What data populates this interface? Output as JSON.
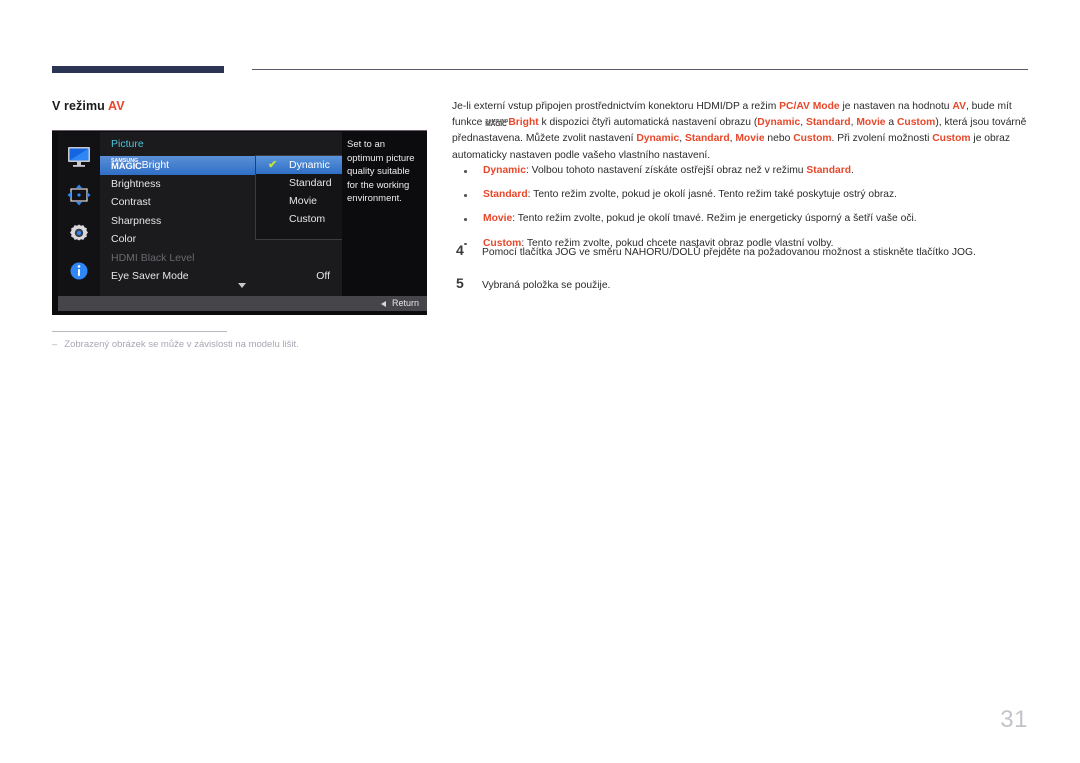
{
  "header": {
    "bar_accent_color": "#2b3553",
    "rule_color": "#5a5a6e"
  },
  "section": {
    "heading_prefix": "V režimu ",
    "heading_accent": "AV"
  },
  "osd": {
    "title": "Picture",
    "sidebar_icons": [
      "monitor-icon",
      "move-arrows-icon",
      "gear-icon",
      "info-icon"
    ],
    "menu_items": [
      {
        "label_prefix": "",
        "logo": "SAMSUNG MAGIC",
        "label": "Bright",
        "value": "",
        "state": "selected"
      },
      {
        "label": "Brightness",
        "value": "",
        "state": "normal"
      },
      {
        "label": "Contrast",
        "value": "",
        "state": "normal"
      },
      {
        "label": "Sharpness",
        "value": "",
        "state": "normal"
      },
      {
        "label": "Color",
        "value": "",
        "state": "normal"
      },
      {
        "label": "HDMI Black Level",
        "value": "",
        "state": "disabled"
      },
      {
        "label": "Eye Saver Mode",
        "value": "Off",
        "state": "normal"
      }
    ],
    "submenu": [
      {
        "label": "Dynamic",
        "checked": true,
        "state": "selected"
      },
      {
        "label": "Standard",
        "checked": false,
        "state": "normal"
      },
      {
        "label": "Movie",
        "checked": false,
        "state": "normal"
      },
      {
        "label": "Custom",
        "checked": false,
        "state": "normal"
      }
    ],
    "check_glyph": "✔",
    "description": "Set to an optimum picture quality suitable for the working environment.",
    "return_label": "Return",
    "highlight_color": "#2f6fc6",
    "title_color": "#4fc3d9",
    "check_color": "#bfe437"
  },
  "footnote": {
    "dash": "‒",
    "text": "Zobrazený obrázek se může v závislosti na modelu lišit."
  },
  "body": {
    "para_1_a": "Je-li externí vstup připojen prostřednictvím konektoru HDMI/DP a režim ",
    "kw_pcav": "PC/AV Mode",
    "para_1_b": " je nastaven na hodnotu ",
    "kw_av": "AV",
    "para_1_c": ", bude mít funkce ",
    "kw_bright": "Bright",
    "para_1_d": " k dispozici čtyři automatická nastavení obrazu (",
    "kw_dynamic": "Dynamic",
    "sep_1": ", ",
    "kw_standard": "Standard",
    "sep_2": ", ",
    "kw_movie": "Movie",
    "sep_3": " a ",
    "kw_custom": "Custom",
    "para_1_e": "), která jsou továrně přednastavena. Můžete zvolit nastavení ",
    "kw_dynamic_2": "Dynamic",
    "sep_4": ", ",
    "kw_standard_2": "Standard",
    "sep_5": ", ",
    "kw_movie_2": "Movie",
    "sep_6": " nebo ",
    "kw_custom_2": "Custom",
    "para_1_f": ". Při zvolení možnosti ",
    "kw_custom_3": "Custom",
    "para_1_g": " je obraz automaticky nastaven podle vašeho vlastního nastavení.",
    "magic_sam": "SAMSUNG",
    "magic_mag": "MAGIC"
  },
  "bullets": [
    {
      "kw": "Dynamic",
      "text_a": ": Volbou tohoto nastavení získáte ostřejší obraz než v režimu ",
      "kw2": "Standard",
      "text_b": "."
    },
    {
      "kw": "Standard",
      "text_a": ": Tento režim zvolte, pokud je okolí jasné. Tento režim také poskytuje ostrý obraz.",
      "kw2": "",
      "text_b": ""
    },
    {
      "kw": "Movie",
      "text_a": ": Tento režim zvolte, pokud je okolí tmavé. Režim je energeticky úsporný a šetří vaše oči.",
      "kw2": "",
      "text_b": ""
    },
    {
      "kw": "Custom",
      "text_a": ": Tento režim zvolte, pokud chcete nastavit obraz podle vlastní volby.",
      "kw2": "",
      "text_b": ""
    }
  ],
  "steps": [
    {
      "num": "4",
      "text": "Pomocí tlačítka JOG ve směru NAHORU/DOLŮ přejděte na požadovanou možnost a stiskněte tlačítko JOG."
    },
    {
      "num": "5",
      "text": "Vybraná položka se použije."
    }
  ],
  "page": {
    "number": "31"
  }
}
